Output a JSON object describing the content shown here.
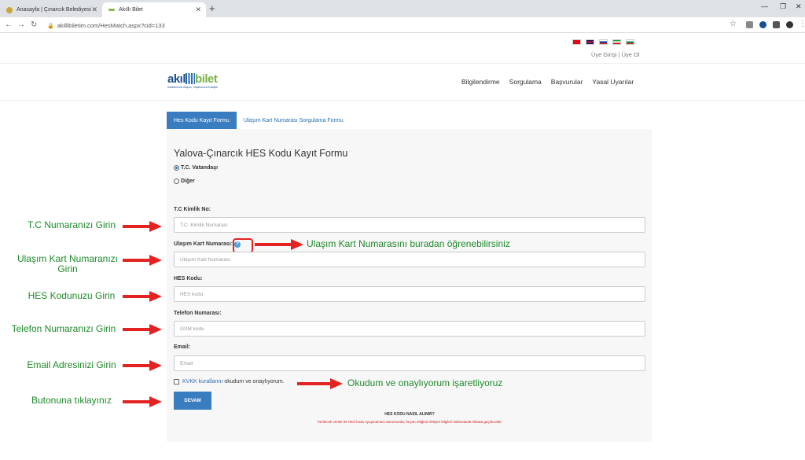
{
  "browser": {
    "tabs": [
      {
        "label": "Anasayfa | Çınarcık Belediyesi"
      },
      {
        "label": "Akıllı Bilet"
      }
    ],
    "url": "akillibiletim.com/HesMatch.aspx?cid=133"
  },
  "header": {
    "logo_akil": "akıl",
    "logo_bilet": "bilet",
    "logo_tagline": "Kartlarınızla Ulaşım, Yaşamınıza Kolaylık",
    "user_links": "Üye Girişi | Üye Ol",
    "menu": [
      "Bilgilendirme",
      "Sorgulama",
      "Başvurular",
      "Yasal Uyarılar"
    ]
  },
  "form_tabs": {
    "active": "Hes Kodu Kayıt Formu",
    "other": "Ulaşım Kart Numarası Sorgulama Formu"
  },
  "form": {
    "title": "Yalova-Çınarcık HES Kodu Kayıt Formu",
    "radio_tc": "T.C. Vatandaşı",
    "radio_other": "Diğer",
    "tc_label": "T.C Kimlik No:",
    "tc_placeholder": "T.C. Kimlik Numarası",
    "card_label": "Ulaşım Kart Numarası:",
    "card_placeholder": "Ulaşım Kart Numarası",
    "hes_label": "HES Kodu:",
    "hes_placeholder": "HES kodu",
    "phone_label": "Telefon Numarası:",
    "phone_placeholder": "GSM kodu",
    "email_label": "Email:",
    "email_placeholder": "Email",
    "kvkk_link": "KVKK kurallarını",
    "kvkk_text": "okudum ve onaylıyorum.",
    "submit": "DEVAM",
    "how": "HES KODU NASIL ALINIR?",
    "note": "*Girilecek veriler ile HES kodu uyuşmaması durumunda, beyan ettiğiniz iletişim bilgileri kullanılarak irtibata geçilecektir."
  },
  "annotations": {
    "tc": "T.C Numaranızı Girin",
    "card": "Ulaşım Kart Numaranızı Girin",
    "hes": "HES Kodunuzu Girin",
    "phone": "Telefon Numaranızı Girin",
    "email": "Email Adresinizi Girin",
    "button": "Butonuna tıklayınız",
    "card_help": "Ulaşım Kart Numarasını buradan öğrenebilirsiniz",
    "kvkk": "Okudum ve onaylıyorum işaretliyoruz"
  },
  "colors": {
    "annotation_text": "#1e8a2a",
    "arrow": "#e32222",
    "primary": "#3a7cc0"
  }
}
